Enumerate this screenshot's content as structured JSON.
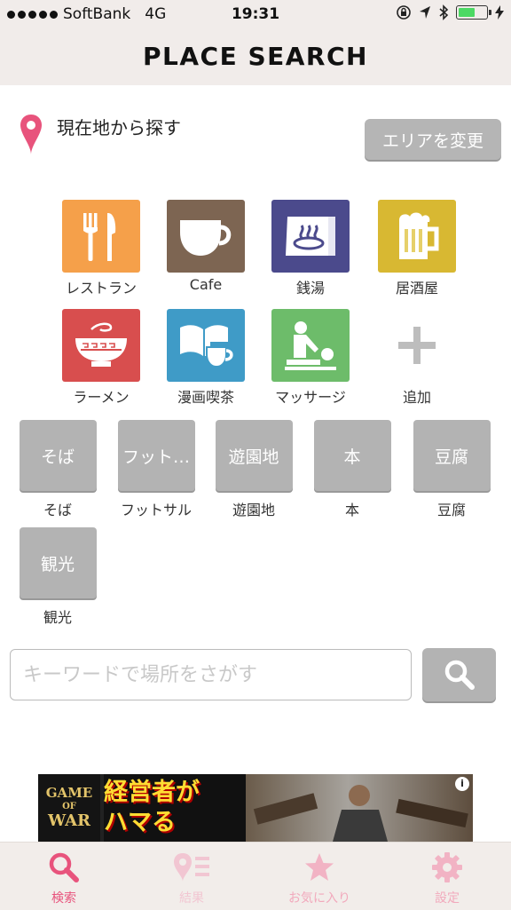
{
  "status_bar": {
    "carrier": "SoftBank",
    "network": "4G",
    "time": "19:31",
    "battery_level": 0.65
  },
  "header": {
    "title": "PLACE SEARCH"
  },
  "location": {
    "label": "現在地から探す",
    "change_area_button": "エリアを変更"
  },
  "categories": [
    {
      "label": "レストラン",
      "icon": "fork-knife-icon",
      "color": "#f5a04a"
    },
    {
      "label": "Cafe",
      "icon": "coffee-cup-icon",
      "color": "#7d6552"
    },
    {
      "label": "銭湯",
      "icon": "hot-spring-icon",
      "color": "#4b4a8c"
    },
    {
      "label": "居酒屋",
      "icon": "beer-mug-icon",
      "color": "#d8b832"
    },
    {
      "label": "ラーメン",
      "icon": "ramen-bowl-icon",
      "color": "#d84e4e"
    },
    {
      "label": "漫画喫茶",
      "icon": "book-cup-icon",
      "color": "#3f9bc7"
    },
    {
      "label": "マッサージ",
      "icon": "massage-icon",
      "color": "#6dbc6a"
    },
    {
      "label": "追加",
      "icon": "plus-icon",
      "color": "#bdbdbd"
    }
  ],
  "custom_tags": [
    {
      "box_label": "そば",
      "caption": "そば"
    },
    {
      "box_label": "フット…",
      "caption": "フットサル"
    },
    {
      "box_label": "遊園地",
      "caption": "遊園地"
    },
    {
      "box_label": "本",
      "caption": "本"
    },
    {
      "box_label": "豆腐",
      "caption": "豆腐"
    },
    {
      "box_label": "観光",
      "caption": "観光"
    }
  ],
  "search": {
    "placeholder": "キーワードで場所をさがす",
    "button_icon": "search-icon"
  },
  "ad": {
    "logo_text_1": "GAME",
    "logo_text_2": "OF",
    "logo_text_3": "WAR",
    "headline_1": "経営者が",
    "headline_2": "ハマる",
    "info_badge": "i"
  },
  "tabs": [
    {
      "label": "検索",
      "icon": "search-icon",
      "active": true
    },
    {
      "label": "結果",
      "icon": "results-icon",
      "active": false
    },
    {
      "label": "お気に入り",
      "icon": "star-icon",
      "active": false
    },
    {
      "label": "設定",
      "icon": "gear-icon",
      "active": false
    }
  ],
  "colors": {
    "accent_pink": "#e8537c",
    "inactive_pink": "#f2b3c4",
    "chip_gray": "#b3b3b3",
    "header_bg": "#f1ecea"
  }
}
